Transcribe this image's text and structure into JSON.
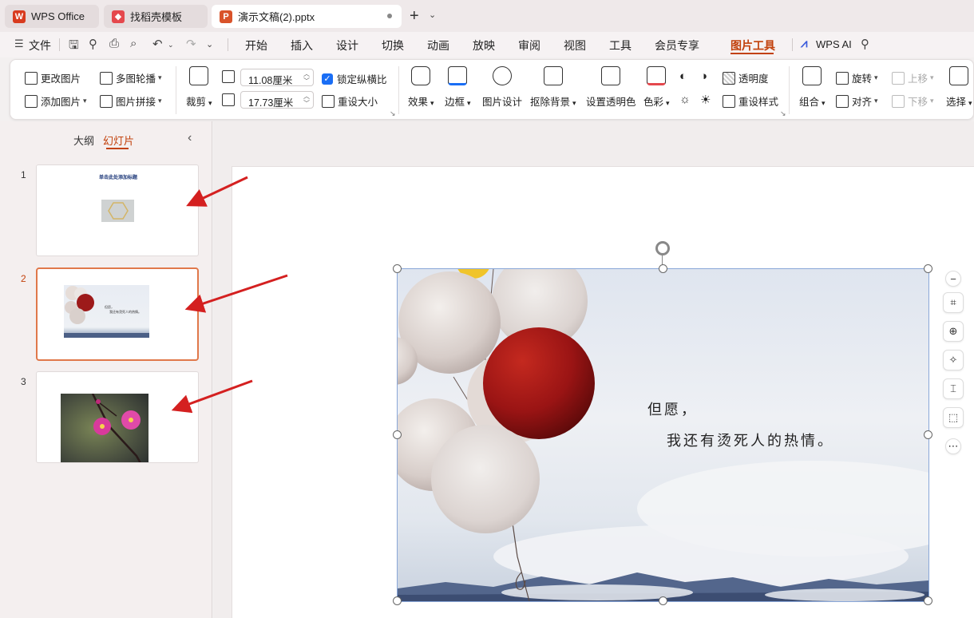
{
  "tabs": [
    {
      "label": "WPS Office",
      "icon": "wps-logo-icon",
      "color": "#d83b1f"
    },
    {
      "label": "找稻壳模板",
      "icon": "docer-logo-icon",
      "color": "#e5484d"
    },
    {
      "label": "演示文稿(2).pptx",
      "icon": "ppt-file-icon",
      "color": "#d9532a"
    }
  ],
  "menu": {
    "file": "文件",
    "items": [
      "开始",
      "插入",
      "设计",
      "切换",
      "动画",
      "放映",
      "审阅",
      "视图",
      "工具",
      "会员专享",
      "图片工具"
    ],
    "active": "图片工具",
    "ai": "WPS AI"
  },
  "ribbon": {
    "change_picture": "更改图片",
    "add_picture": "添加图片",
    "multi_carousel": "多图轮播",
    "picture_stitch": "图片拼接",
    "crop": "裁剪",
    "width_value": "11.08厘米",
    "height_value": "17.73厘米",
    "lock_ratio": "锁定纵横比",
    "reset_size": "重设大小",
    "effects": "效果",
    "border": "边框",
    "picture_design": "图片设计",
    "remove_background": "抠除背景",
    "set_transparent_color": "设置透明色",
    "color": "色彩",
    "transparency": "透明度",
    "reset_style": "重设样式",
    "group": "组合",
    "rotate": "旋转",
    "align": "对齐",
    "bring_forward": "上移",
    "send_backward": "下移",
    "select": "选择"
  },
  "panel": {
    "outline_tab": "大纲",
    "slides_tab": "幻灯片",
    "slide_numbers": [
      "1",
      "2",
      "3"
    ],
    "slide1_title": "单击此处添加标题",
    "slide2_line1": "但愿，",
    "slide2_line2": "我还有烫死人的热情。"
  },
  "slide": {
    "line1": "但愿，",
    "line2": "我还有烫死人的热情。"
  },
  "colors": {
    "accent": "#c2410c",
    "arrow": "#d42020",
    "selection_border": "#e0784a"
  }
}
